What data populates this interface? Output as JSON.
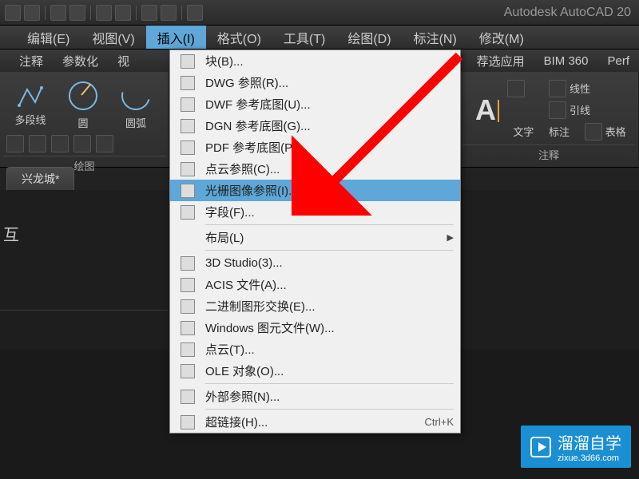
{
  "app_title": "Autodesk AutoCAD 20",
  "menubar": [
    "编辑(E)",
    "视图(V)",
    "插入(I)",
    "格式(O)",
    "工具(T)",
    "绘图(D)",
    "标注(N)",
    "修改(M)"
  ],
  "menubar_open_index": 2,
  "ribbon_tabs_left": [
    "注释",
    "参数化",
    "视"
  ],
  "ribbon_tabs_right": [
    "荐选应用",
    "BIM 360",
    "Perf"
  ],
  "draw_panel": {
    "label": "绘图",
    "polyline": "多段线",
    "circle": "圆",
    "arc": "圆弧"
  },
  "ann_panel": {
    "label": "注释",
    "items": [
      "线性",
      "引线",
      "表格"
    ],
    "text": "文字",
    "dim": "标注"
  },
  "file_tab": "兴龙城*",
  "side_char": "互",
  "dropdown": {
    "items": [
      {
        "label": "块(B)...",
        "icon": "block-icon"
      },
      {
        "label": "DWG 参照(R)...",
        "icon": "dwg-icon"
      },
      {
        "label": "DWF 参考底图(U)...",
        "icon": "dwf-icon"
      },
      {
        "label": "DGN 参考底图(G)...",
        "icon": "dgn-icon"
      },
      {
        "label": "PDF 参考底图(P)...",
        "icon": "pdf-icon"
      },
      {
        "label": "点云参照(C)...",
        "icon": "pointcloud-icon"
      },
      {
        "label": "光栅图像参照(I)...",
        "icon": "raster-icon",
        "hover": true
      },
      {
        "label": "字段(F)...",
        "icon": "field-icon"
      },
      {
        "sep": true
      },
      {
        "label": "布局(L)",
        "icon": "",
        "submenu": true
      },
      {
        "sep": true
      },
      {
        "label": "3D Studio(3)...",
        "icon": "3ds-icon"
      },
      {
        "label": "ACIS 文件(A)...",
        "icon": "acis-icon"
      },
      {
        "label": "二进制图形交换(E)...",
        "icon": "binary-icon"
      },
      {
        "label": "Windows 图元文件(W)...",
        "icon": "wmf-icon"
      },
      {
        "label": "点云(T)...",
        "icon": "pointcloud2-icon"
      },
      {
        "label": "OLE 对象(O)...",
        "icon": "ole-icon"
      },
      {
        "sep": true
      },
      {
        "label": "外部参照(N)...",
        "icon": "xref-icon"
      },
      {
        "sep": true
      },
      {
        "label": "超链接(H)...",
        "icon": "hyperlink-icon",
        "shortcut": "Ctrl+K"
      }
    ]
  },
  "watermark": {
    "brand": "溜溜自学",
    "url": "zixue.3d66.com"
  }
}
